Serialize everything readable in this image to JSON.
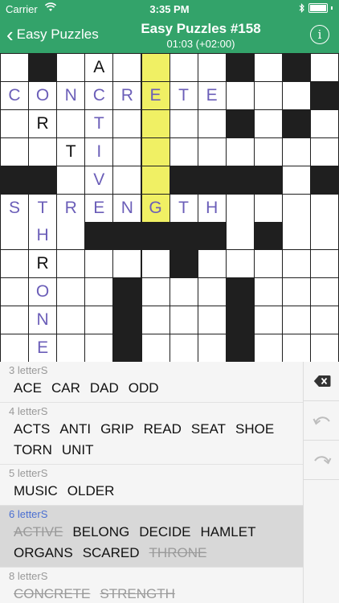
{
  "status_bar": {
    "carrier": "Carrier",
    "time": "3:35 PM"
  },
  "nav": {
    "back_label": "Easy Puzzles",
    "title": "Easy Puzzles #158",
    "subtitle": "01:03 (+02:00)",
    "info_label": "i"
  },
  "colors": {
    "accent": "#33a36a",
    "placed_letter": "#6b5eb8",
    "highlight": "#f0f064",
    "group_selected": "#4a6fd1"
  },
  "grid": {
    "rows": [
      "W.WAWYWW.W.W",
      "CONCRETEWWW.",
      "WRWTWYWW.W.W",
      "WWTIWYWWWWWW",
      "..WVWY....W.",
      "STRENGTHWWWW",
      "WHW.....W.WW",
      "WRWWWW.WWWWW",
      "WOWW.WWW.WWW",
      "WNWW.WWW.WWW",
      "WEWW.WWW.WWW"
    ],
    "cells": [
      {
        "r": 0,
        "c": 3,
        "letter": "A",
        "type": "given"
      },
      {
        "r": 1,
        "c": 0,
        "letter": "C",
        "type": "placed"
      },
      {
        "r": 1,
        "c": 1,
        "letter": "O",
        "type": "placed"
      },
      {
        "r": 1,
        "c": 2,
        "letter": "N",
        "type": "placed"
      },
      {
        "r": 1,
        "c": 3,
        "letter": "C",
        "type": "placed"
      },
      {
        "r": 1,
        "c": 4,
        "letter": "R",
        "type": "placed"
      },
      {
        "r": 1,
        "c": 5,
        "letter": "E",
        "type": "placed",
        "hl": true
      },
      {
        "r": 1,
        "c": 6,
        "letter": "T",
        "type": "placed"
      },
      {
        "r": 1,
        "c": 7,
        "letter": "E",
        "type": "placed"
      },
      {
        "r": 2,
        "c": 1,
        "letter": "R",
        "type": "given"
      },
      {
        "r": 2,
        "c": 3,
        "letter": "T",
        "type": "placed"
      },
      {
        "r": 3,
        "c": 2,
        "letter": "T",
        "type": "given"
      },
      {
        "r": 3,
        "c": 3,
        "letter": "I",
        "type": "placed"
      },
      {
        "r": 4,
        "c": 3,
        "letter": "V",
        "type": "placed"
      },
      {
        "r": 5,
        "c": 0,
        "letter": "S",
        "type": "placed"
      },
      {
        "r": 5,
        "c": 1,
        "letter": "T",
        "type": "placed"
      },
      {
        "r": 5,
        "c": 2,
        "letter": "R",
        "type": "placed"
      },
      {
        "r": 5,
        "c": 3,
        "letter": "E",
        "type": "placed"
      },
      {
        "r": 5,
        "c": 4,
        "letter": "N",
        "type": "placed"
      },
      {
        "r": 5,
        "c": 5,
        "letter": "G",
        "type": "placed",
        "hl": true
      },
      {
        "r": 5,
        "c": 6,
        "letter": "T",
        "type": "placed"
      },
      {
        "r": 5,
        "c": 7,
        "letter": "H",
        "type": "placed"
      },
      {
        "r": 6,
        "c": 1,
        "letter": "H",
        "type": "placed"
      },
      {
        "r": 7,
        "c": 1,
        "letter": "R",
        "type": "given"
      },
      {
        "r": 8,
        "c": 1,
        "letter": "O",
        "type": "placed"
      },
      {
        "r": 9,
        "c": 1,
        "letter": "N",
        "type": "placed"
      },
      {
        "r": 10,
        "c": 1,
        "letter": "E",
        "type": "placed"
      }
    ]
  },
  "word_groups": [
    {
      "header": "3 letterS",
      "selected": false,
      "words": [
        {
          "text": "ACE",
          "used": false
        },
        {
          "text": "CAR",
          "used": false
        },
        {
          "text": "DAD",
          "used": false
        },
        {
          "text": "ODD",
          "used": false
        }
      ]
    },
    {
      "header": "4 letterS",
      "selected": false,
      "words": [
        {
          "text": "ACTS",
          "used": false
        },
        {
          "text": "ANTI",
          "used": false
        },
        {
          "text": "GRIP",
          "used": false
        },
        {
          "text": "READ",
          "used": false
        },
        {
          "text": "SEAT",
          "used": false
        },
        {
          "text": "SHOE",
          "used": false
        },
        {
          "text": "TORN",
          "used": false
        },
        {
          "text": "UNIT",
          "used": false
        }
      ]
    },
    {
      "header": "5 letterS",
      "selected": false,
      "words": [
        {
          "text": "MUSIC",
          "used": false
        },
        {
          "text": "OLDER",
          "used": false
        }
      ]
    },
    {
      "header": "6 letterS",
      "selected": true,
      "words": [
        {
          "text": "ACTIVE",
          "used": true
        },
        {
          "text": "BELONG",
          "used": false
        },
        {
          "text": "DECIDE",
          "used": false
        },
        {
          "text": "HAMLET",
          "used": false
        },
        {
          "text": "ORGANS",
          "used": false
        },
        {
          "text": "SCARED",
          "used": false
        },
        {
          "text": "THRONE",
          "used": true
        }
      ]
    },
    {
      "header": "8 letterS",
      "selected": false,
      "words": [
        {
          "text": "CONCRETE",
          "used": true
        },
        {
          "text": "STRENGTH",
          "used": true
        }
      ]
    }
  ],
  "tools": {
    "delete": "backspace-icon",
    "undo": "undo-icon",
    "redo": "redo-icon"
  }
}
